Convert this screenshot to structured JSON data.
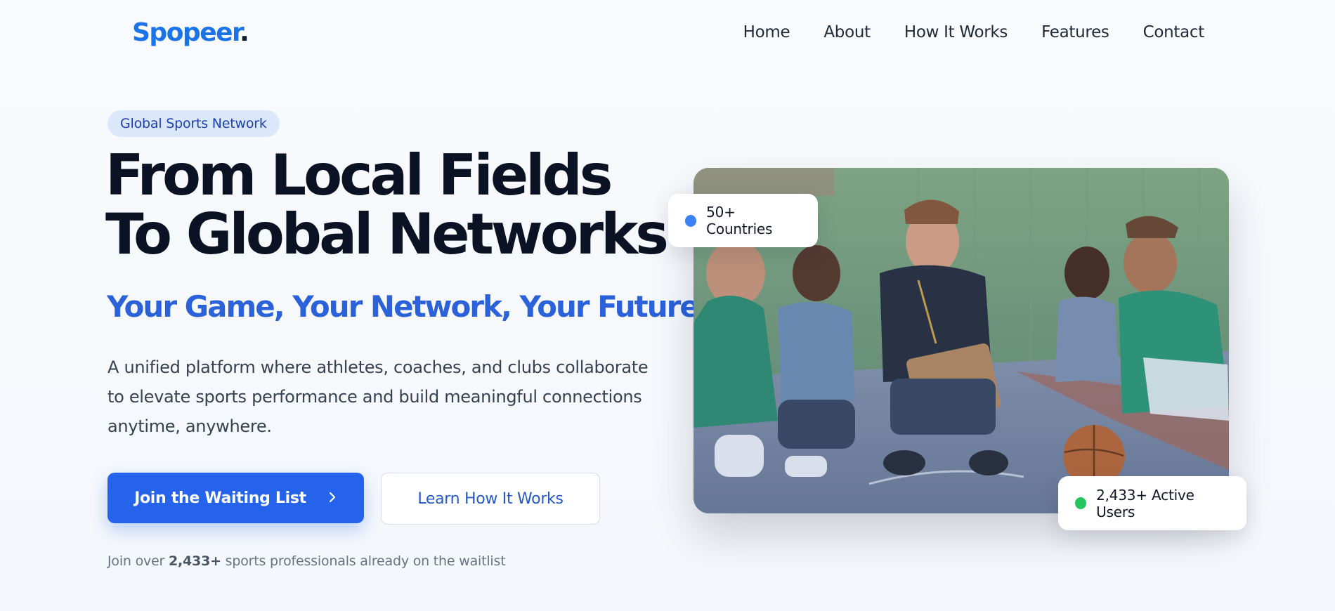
{
  "brand": {
    "name": "Spopeer",
    "dot": ".",
    "color": "#1a73e8"
  },
  "nav": {
    "links": [
      "Home",
      "About",
      "How It Works",
      "Features",
      "Contact"
    ]
  },
  "hero": {
    "badge": "Global Sports Network",
    "headline_line1": "From Local Fields",
    "headline_line2": "To Global Networks",
    "subheadline": "Your Game, Your Network, Your Future",
    "description": "A unified platform where athletes, coaches, and clubs collaborate to elevate sports performance and build meaningful connections anytime, anywhere.",
    "primary_button": "Join the Waiting List",
    "secondary_button": "Learn How It Works",
    "waitlist_prefix": "Join over ",
    "waitlist_count": "2,433+",
    "waitlist_suffix": " sports professionals already on the waitlist"
  },
  "stats": {
    "countries": {
      "label": "50+ Countries",
      "dot_color": "#3b82f6"
    },
    "active_users": {
      "label": "2,433+ Active Users",
      "dot_color": "#22c55e"
    }
  },
  "image": {
    "subject": "coach with clipboard huddled with young basketball players on an outdoor court"
  },
  "colors": {
    "accent": "#2563eb",
    "subhead": "#2b62d9",
    "badge_bg": "#dbe7fb"
  }
}
